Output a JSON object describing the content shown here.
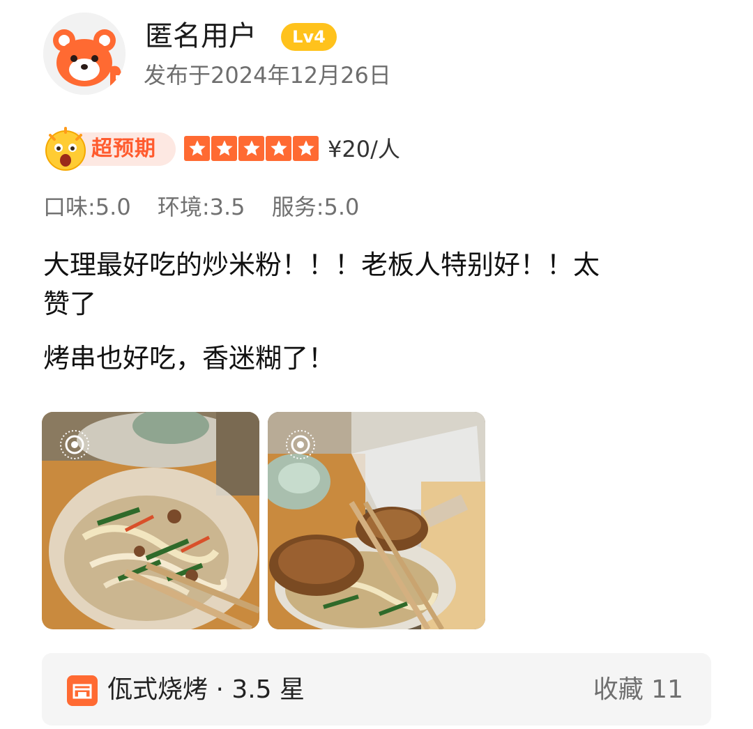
{
  "user": {
    "name": "匿名用户",
    "level": "Lv4",
    "date": "发布于2024年12月26日"
  },
  "rating_row": {
    "badge": "超预期",
    "stars": 5,
    "price": "¥20/人"
  },
  "sub_ratings": [
    "口味:5.0",
    "环境:3.5",
    "服务:5.0"
  ],
  "review": {
    "line1": "大理最好吃的炒米粉！！！老板人特别好！！太",
    "line2": "赞了",
    "line3": "烤串也好吃，香迷糊了！"
  },
  "footer": {
    "shop": "佤式烧烤 · 3.5 星",
    "collect": "收藏 11"
  },
  "colors": {
    "accent": "#ff6a32",
    "badge_bg": "#fde8e2",
    "level": "#ffc21c"
  },
  "icons": [
    "avatar-red-panda-icon",
    "surprised-emoji-icon",
    "star-icon",
    "live-photo-icon",
    "shop-icon"
  ]
}
